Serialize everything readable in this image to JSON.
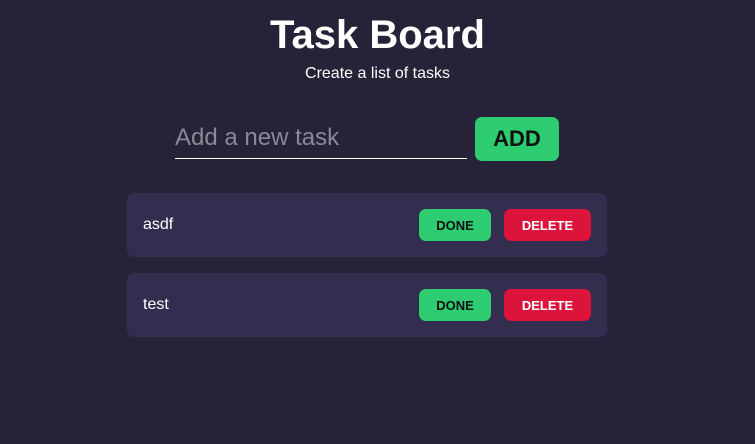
{
  "header": {
    "title": "Task Board",
    "subtitle": "Create a list of tasks"
  },
  "add_form": {
    "input_value": "",
    "input_placeholder": "Add a new task",
    "add_label": "ADD"
  },
  "tasks": [
    {
      "text": "asdf",
      "done_label": "DONE",
      "delete_label": "DELETE"
    },
    {
      "text": "test",
      "done_label": "DONE",
      "delete_label": "DELETE"
    }
  ],
  "colors": {
    "background": "#262338",
    "card": "#332d4f",
    "done_green": "#2ecc71",
    "delete_red": "#dc143c"
  }
}
